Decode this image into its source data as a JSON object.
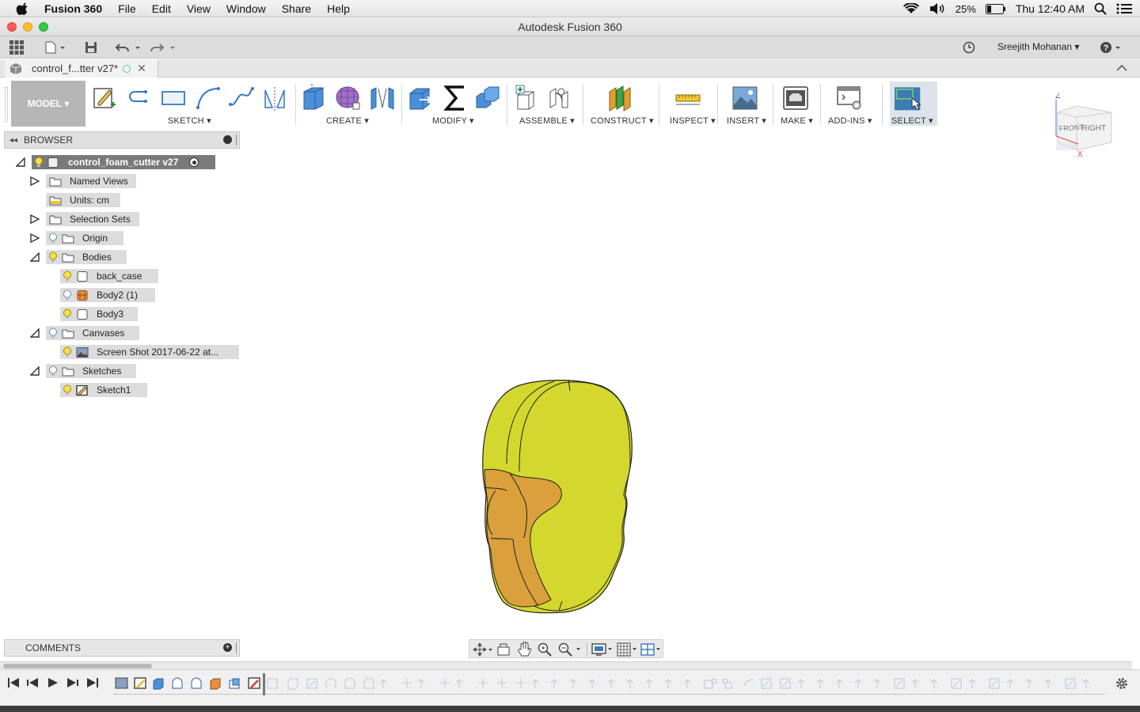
{
  "menubar": {
    "app_name": "Fusion 360",
    "items": [
      "File",
      "Edit",
      "View",
      "Window",
      "Share",
      "Help"
    ],
    "battery": "25%",
    "clock": "Thu 12:40 AM"
  },
  "window": {
    "title": "Autodesk Fusion 360"
  },
  "quick_access": {
    "user_name": "Sreejith Mohanan"
  },
  "document_tab": {
    "label": "control_f...tter v27*"
  },
  "ribbon": {
    "workspace": "MODEL",
    "groups": [
      "SKETCH",
      "CREATE",
      "MODIFY",
      "ASSEMBLE",
      "CONSTRUCT",
      "INSPECT",
      "INSERT",
      "MAKE",
      "ADD-INS",
      "SELECT"
    ]
  },
  "browser": {
    "title": "BROWSER",
    "root": "control_foam_cutter v27",
    "nodes": {
      "named_views": "Named Views",
      "units": "Units: cm",
      "selection_sets": "Selection Sets",
      "origin": "Origin",
      "bodies": "Bodies",
      "back_case": "back_case",
      "body2": "Body2 (1)",
      "body3": "Body3",
      "canvases": "Canvases",
      "screenshot": "Screen Shot 2017-06-22 at...",
      "sketches": "Sketches",
      "sketch1": "Sketch1"
    }
  },
  "viewcube": {
    "front": "FRONT",
    "right": "RIGHT",
    "axis_z": "Z",
    "axis_x": "X"
  },
  "comments": {
    "label": "COMMENTS"
  },
  "colors": {
    "body_yellow": "#d4d82e",
    "body_orange": "#d9a03c",
    "select_blue": "#3c7bb5"
  }
}
